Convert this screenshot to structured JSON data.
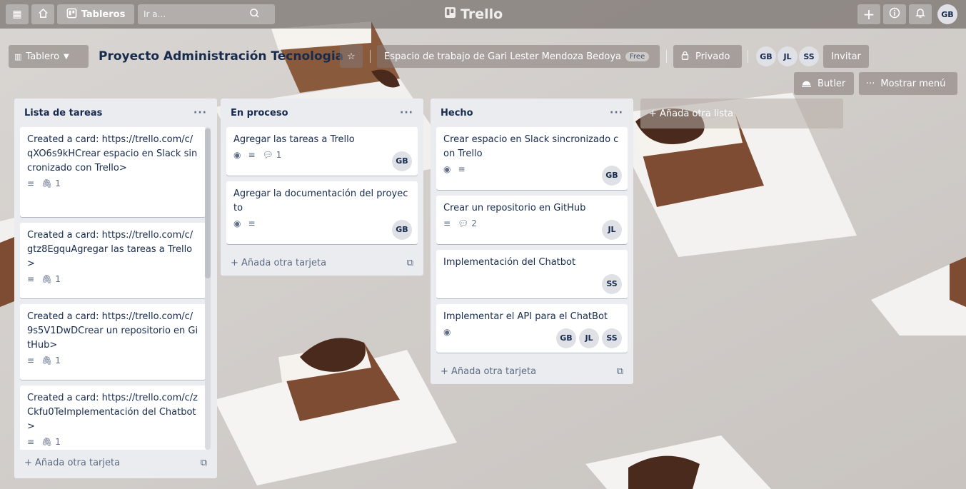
{
  "topbar": {
    "boards_label": "Tableros",
    "search_placeholder": "Ir a...",
    "brand": "Trello",
    "user_initials": "GB"
  },
  "board": {
    "view_label": "Tablero",
    "title": "Proyecto Administración Tecnologia",
    "workspace_label": "Espacio de trabajo de Gari Lester Mendoza Bedoya",
    "workspace_plan": "Free",
    "visibility_label": "Privado",
    "members": [
      "GB",
      "JL",
      "SS"
    ],
    "invite_label": "Invitar",
    "butler_label": "Butler",
    "menu_label": "Mostrar menú"
  },
  "lists": [
    {
      "name": "Lista de tareas",
      "menu": "···",
      "add_card_label": "Añada otra tarjeta",
      "cards": [
        {
          "title": "Created a card: https://trello.com/c/qXO6s9kHCrear espacio en Slack sincronizado con Trello>",
          "attachments": "1"
        },
        {
          "title": "Created a card: https://trello.com/c/gtz8EgquAgregar las tareas a Trello>",
          "attachments": "1"
        },
        {
          "title": "Created a card: https://trello.com/c/9s5V1DwDCrear un repositorio en GitHub>",
          "attachments": "1"
        },
        {
          "title": "Created a card: https://trello.com/c/zCkfu0TeImplementación del Chatbot>",
          "attachments": "1"
        }
      ]
    },
    {
      "name": "En proceso",
      "menu": "···",
      "add_card_label": "Añada otra tarjeta",
      "cards": [
        {
          "title": "Agregar las tareas a Trello",
          "comments": "1",
          "members": [
            "GB"
          ]
        },
        {
          "title": "Agregar la documentación del proyecto",
          "members": [
            "GB"
          ]
        }
      ]
    },
    {
      "name": "Hecho",
      "menu": "···",
      "add_card_label": "Añada otra tarjeta",
      "cards": [
        {
          "title": "Crear espacio en Slack sincronizado con Trello",
          "members": [
            "GB"
          ]
        },
        {
          "title": "Crear un repositorio en GitHub",
          "comments": "2",
          "members": [
            "JL"
          ]
        },
        {
          "title": "Implementación del Chatbot",
          "members": [
            "SS"
          ]
        },
        {
          "title": "Implementar el API para el ChatBot",
          "members": [
            "GB",
            "JL",
            "SS"
          ]
        }
      ]
    }
  ],
  "add_list_label": "Añada otra lista",
  "colors": {
    "list_bg": "#ebecf0",
    "text": "#172b4d",
    "muted": "#5e6c84",
    "avatar_bg": "#dfe1e6"
  }
}
